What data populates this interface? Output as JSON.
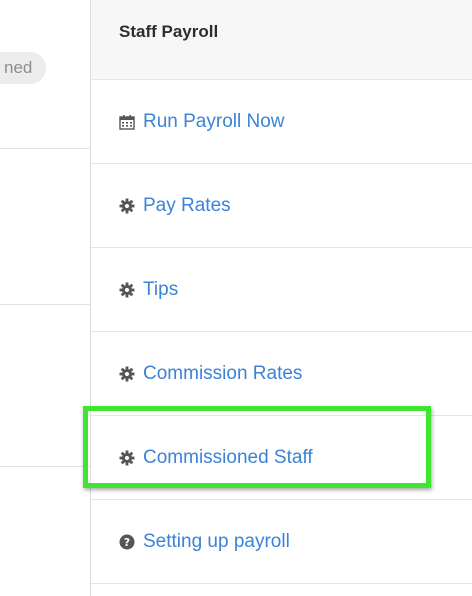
{
  "left_panel": {
    "status_pill_text": "ned"
  },
  "menu": {
    "title": "Staff Payroll",
    "items": [
      {
        "label": "Run Payroll Now",
        "icon": "calendar-icon"
      },
      {
        "label": "Pay Rates",
        "icon": "gear-icon"
      },
      {
        "label": "Tips",
        "icon": "gear-icon"
      },
      {
        "label": "Commission Rates",
        "icon": "gear-icon"
      },
      {
        "label": "Commissioned Staff",
        "icon": "gear-icon",
        "highlighted": true
      },
      {
        "label": "Setting up payroll",
        "icon": "question-circle-icon"
      }
    ]
  },
  "colors": {
    "link": "#3a83d7",
    "highlight_border": "#3ee62f",
    "header_bg": "#f7f7f7",
    "icon": "#555555"
  }
}
